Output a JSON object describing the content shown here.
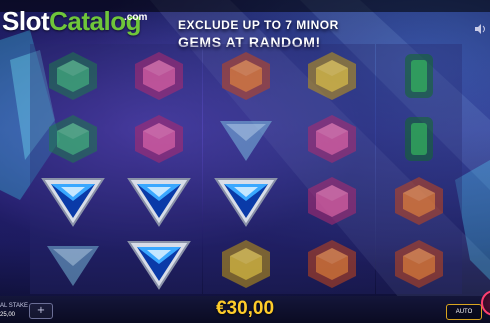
{
  "logo": {
    "slot": "Slot",
    "catalog": "Catalog",
    "com": ".com"
  },
  "promo": {
    "line1": "EXCLUDE UP TO 7 MINOR",
    "line2": "GEMS AT RANDOM!"
  },
  "reels": [
    [
      "green-gem",
      "green-gem",
      "blue-triangle-gem",
      "cyan-triangle-gem"
    ],
    [
      "pink-gem",
      "pink-gem",
      "blue-triangle-gem",
      "blue-triangle-gem"
    ],
    [
      "orange-gem",
      "cyan-triangle-gem",
      "blue-triangle-gem",
      "yellow-gem"
    ],
    [
      "yellow-gem",
      "pink-gem",
      "pink-gem",
      "orange-gem"
    ],
    [
      "green-emerald",
      "green-emerald",
      "orange-gem",
      "orange-gem"
    ]
  ],
  "highlighted": [
    [
      0,
      2
    ],
    [
      1,
      2
    ],
    [
      1,
      3
    ],
    [
      2,
      2
    ]
  ],
  "footer": {
    "stake_label": "AL STAKE",
    "stake_value": "25,00",
    "plus_button": "+",
    "win_amount": "€30,00",
    "auto_button": "AUTO"
  },
  "colors": {
    "win": "#ffcc2a",
    "logo_green": "#6fc63a",
    "auto_border": "#d9a520",
    "spin_ring": "#ff4070"
  }
}
